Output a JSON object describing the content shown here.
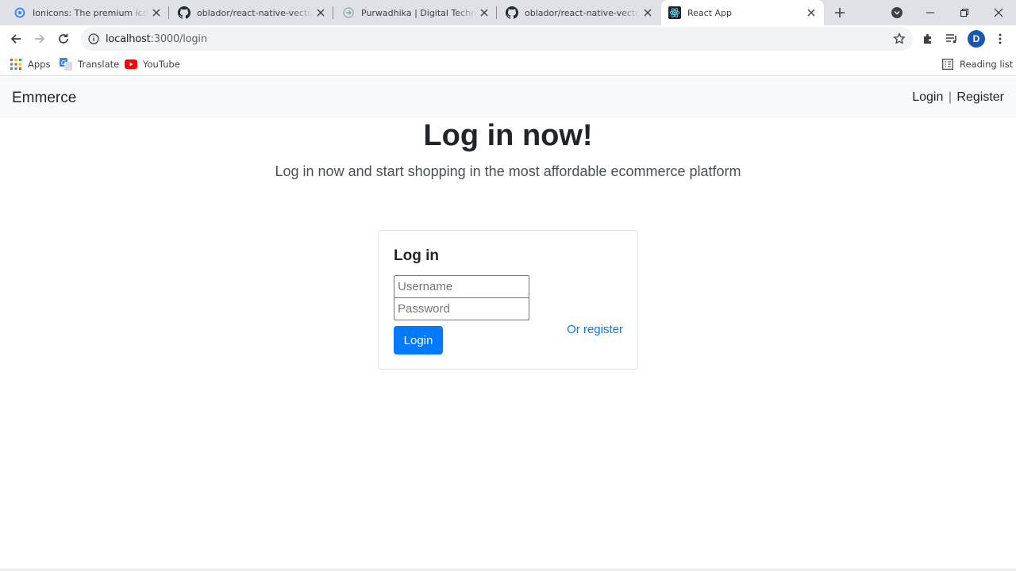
{
  "browser": {
    "tabs": [
      {
        "title": "Ionicons: The premium icon pack",
        "icon": "ionicons-icon"
      },
      {
        "title": "oblador/react-native-vector-icons",
        "icon": "github-icon"
      },
      {
        "title": "Purwadhika | Digital Technology School",
        "icon": "purwadhika-icon"
      },
      {
        "title": "oblador/react-native-vector-icons",
        "icon": "github-icon"
      },
      {
        "title": "React App",
        "icon": "react-icon"
      }
    ],
    "active_tab_index": 4,
    "address": {
      "host": "localhost",
      "path": ":3000/login"
    },
    "profile_initial": "D",
    "bookmarks": [
      {
        "label": "Apps",
        "icon": "apps-grid-icon"
      },
      {
        "label": "Translate",
        "icon": "translate-icon"
      },
      {
        "label": "YouTube",
        "icon": "youtube-icon"
      }
    ],
    "reading_list": "Reading list"
  },
  "page": {
    "brand": "Emmerce",
    "nav": {
      "login": "Login",
      "separator": "|",
      "register": "Register"
    },
    "hero": {
      "title": "Log in now!",
      "subtitle": "Log in now and start shopping in the most affordable ecommerce platform"
    },
    "form": {
      "title": "Log in",
      "username_placeholder": "Username",
      "password_placeholder": "Password",
      "login_button": "Login",
      "register_link": "Or register"
    }
  },
  "colors": {
    "primary": "#007bff",
    "navbar_bg": "#f8f9fa",
    "text": "#212529"
  }
}
